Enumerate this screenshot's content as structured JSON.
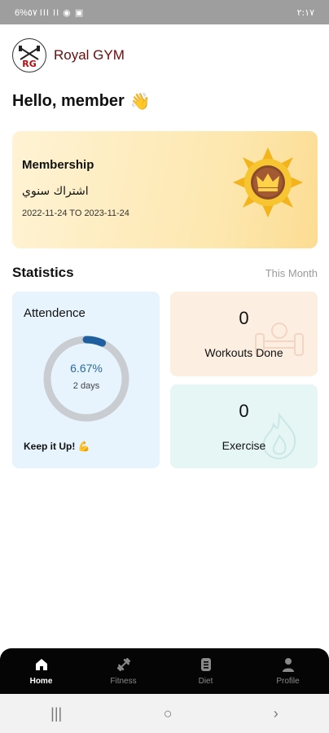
{
  "status_bar": {
    "left": "6%٥٧ III II ◉ ▣",
    "time": "٢:١٧"
  },
  "header": {
    "app_title": "Royal GYM",
    "logo_icon": "rg-logo-icon"
  },
  "greeting": {
    "text": "Hello, member",
    "emoji": "👋"
  },
  "membership": {
    "title": "Membership",
    "plan_ar": "اشتراك سنوي",
    "dates": "2022-11-24 TO 2023-11-24",
    "badge_icon": "crown-badge-icon"
  },
  "statistics": {
    "title": "Statistics",
    "period": "This Month",
    "attendance": {
      "title": "Attendence",
      "percent_text": "6.67%",
      "percent_value": 6.67,
      "days": "2 days",
      "footer": "Keep it Up! 💪"
    },
    "workouts": {
      "value": "0",
      "label": "Workouts Done"
    },
    "exercise": {
      "value": "0",
      "label": "Exercise"
    }
  },
  "bottom_nav": [
    {
      "label": "Home",
      "icon": "home-icon",
      "active": true
    },
    {
      "label": "Fitness",
      "icon": "dumbbell-icon",
      "active": false
    },
    {
      "label": "Diet",
      "icon": "diet-icon",
      "active": false
    },
    {
      "label": "Profile",
      "icon": "person-icon",
      "active": false
    }
  ],
  "system_nav": {
    "recents": "|||",
    "home": "○",
    "back": "›"
  },
  "colors": {
    "accent_ring": "#1f5fa0",
    "ring_track": "#c9cdd1",
    "brand_title": "#6b0b0b"
  }
}
